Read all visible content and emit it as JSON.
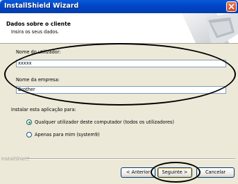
{
  "window": {
    "title": "InstallShield Wizard"
  },
  "header": {
    "title": "Dados sobre o cliente",
    "subtitle": "Insira os seus dados."
  },
  "form": {
    "user_label": "Nome do utilizador:",
    "user_value": "xxxxx",
    "company_label": "Nome da empresa:",
    "company_value": "Brother"
  },
  "install_for": {
    "label": "Instalar esta aplicação para:",
    "options": [
      {
        "label": "Qualquer utilizador deste computador (todos os utilizadores)",
        "selected": true
      },
      {
        "label": "Apenas para mim (system9)",
        "selected": false
      }
    ]
  },
  "footer": {
    "brand": "InstallShield"
  },
  "buttons": {
    "back": "< Anterior",
    "next": "Seguinte >",
    "cancel": "Cancelar"
  }
}
